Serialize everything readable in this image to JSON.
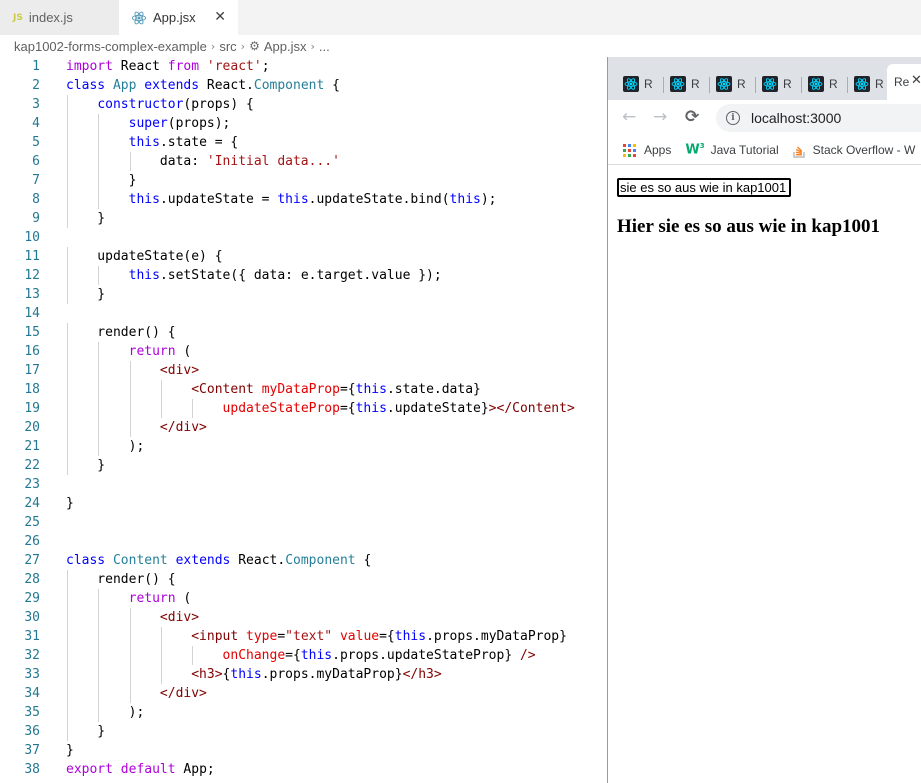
{
  "editor": {
    "tabs": [
      {
        "label": "index.js",
        "icon": "js-file-icon",
        "active": false
      },
      {
        "label": "App.jsx",
        "icon": "react-file-icon",
        "active": true
      }
    ],
    "tab_close_glyph": "✕",
    "breadcrumb": [
      "kap1002-forms-complex-example",
      "src",
      "App.jsx",
      "..."
    ],
    "lines": [
      [
        [
          "import",
          "kwc"
        ],
        [
          " React ",
          ""
        ],
        [
          "from",
          "kwc"
        ],
        [
          " ",
          ""
        ],
        [
          "'react'",
          "str"
        ],
        [
          ";",
          ""
        ]
      ],
      [
        [
          "class",
          "kw"
        ],
        [
          " ",
          ""
        ],
        [
          "App",
          "tk-type"
        ],
        [
          " ",
          ""
        ],
        [
          "extends",
          "kw"
        ],
        [
          " React.",
          ""
        ],
        [
          "Component",
          "tk-type"
        ],
        [
          " {",
          ""
        ]
      ],
      [
        [
          "    ",
          ""
        ],
        [
          "constructor",
          "kw"
        ],
        [
          "(props) {",
          ""
        ]
      ],
      [
        [
          "        ",
          ""
        ],
        [
          "super",
          "kw"
        ],
        [
          "(props);",
          ""
        ]
      ],
      [
        [
          "        ",
          ""
        ],
        [
          "this",
          "kw"
        ],
        [
          ".state = {",
          ""
        ]
      ],
      [
        [
          "            data: ",
          ""
        ],
        [
          "'Initial data...'",
          "str"
        ]
      ],
      [
        [
          "        }",
          ""
        ]
      ],
      [
        [
          "        ",
          ""
        ],
        [
          "this",
          "kw"
        ],
        [
          ".updateState = ",
          ""
        ],
        [
          "this",
          "kw"
        ],
        [
          ".updateState.bind(",
          ""
        ],
        [
          "this",
          "kw"
        ],
        [
          ");",
          ""
        ]
      ],
      [
        [
          "    }",
          ""
        ]
      ],
      [],
      [
        [
          "    updateState(e) {",
          ""
        ]
      ],
      [
        [
          "        ",
          ""
        ],
        [
          "this",
          "kw"
        ],
        [
          ".setState({ data: e.target.value });",
          ""
        ]
      ],
      [
        [
          "    }",
          ""
        ]
      ],
      [],
      [
        [
          "    render() {",
          ""
        ]
      ],
      [
        [
          "        ",
          ""
        ],
        [
          "return",
          "kwc"
        ],
        [
          " (",
          ""
        ]
      ],
      [
        [
          "            ",
          ""
        ],
        [
          "<div>",
          "tag"
        ]
      ],
      [
        [
          "                ",
          ""
        ],
        [
          "<Content",
          "tag"
        ],
        [
          " ",
          ""
        ],
        [
          "myDataProp",
          "attr"
        ],
        [
          "={",
          ""
        ],
        [
          "this",
          "kw"
        ],
        [
          ".state.data}",
          ""
        ]
      ],
      [
        [
          "                    ",
          ""
        ],
        [
          "updateStateProp",
          "attr"
        ],
        [
          "={",
          ""
        ],
        [
          "this",
          "kw"
        ],
        [
          ".updateState}",
          ""
        ],
        [
          "></Content>",
          "tag"
        ]
      ],
      [
        [
          "            ",
          ""
        ],
        [
          "</div>",
          "tag"
        ]
      ],
      [
        [
          "        );",
          ""
        ]
      ],
      [
        [
          "    }",
          ""
        ]
      ],
      [],
      [
        [
          "}",
          ""
        ]
      ],
      [],
      [],
      [
        [
          "class",
          "kw"
        ],
        [
          " ",
          ""
        ],
        [
          "Content",
          "tk-type"
        ],
        [
          " ",
          ""
        ],
        [
          "extends",
          "kw"
        ],
        [
          " React.",
          ""
        ],
        [
          "Component",
          "tk-type"
        ],
        [
          " {",
          ""
        ]
      ],
      [
        [
          "    render() {",
          ""
        ]
      ],
      [
        [
          "        ",
          ""
        ],
        [
          "return",
          "kwc"
        ],
        [
          " (",
          ""
        ]
      ],
      [
        [
          "            ",
          ""
        ],
        [
          "<div>",
          "tag"
        ]
      ],
      [
        [
          "                ",
          ""
        ],
        [
          "<input",
          "tag"
        ],
        [
          " ",
          ""
        ],
        [
          "type",
          "attr"
        ],
        [
          "=",
          ""
        ],
        [
          "\"text\"",
          "str"
        ],
        [
          " ",
          ""
        ],
        [
          "value",
          "attr"
        ],
        [
          "={",
          ""
        ],
        [
          "this",
          "kw"
        ],
        [
          ".props.myDataProp}",
          ""
        ]
      ],
      [
        [
          "                    ",
          ""
        ],
        [
          "onChange",
          "attr"
        ],
        [
          "={",
          ""
        ],
        [
          "this",
          "kw"
        ],
        [
          ".props.updateStateProp} ",
          ""
        ],
        [
          "/>",
          "tag"
        ]
      ],
      [
        [
          "                ",
          ""
        ],
        [
          "<h3>",
          "tag"
        ],
        [
          "{",
          ""
        ],
        [
          "this",
          "kw"
        ],
        [
          ".props.myDataProp}",
          ""
        ],
        [
          "</h3>",
          "tag"
        ]
      ],
      [
        [
          "            ",
          ""
        ],
        [
          "</div>",
          "tag"
        ]
      ],
      [
        [
          "        );",
          ""
        ]
      ],
      [
        [
          "    }",
          ""
        ]
      ],
      [
        [
          "}",
          ""
        ]
      ],
      [
        [
          "export",
          "kwc"
        ],
        [
          " ",
          ""
        ],
        [
          "default",
          "kwc"
        ],
        [
          " App;",
          ""
        ]
      ]
    ]
  },
  "browser": {
    "tab_label": "R",
    "active_tab_label": "Re",
    "tab_close_glyph": "✕",
    "back_glyph": "←",
    "forward_glyph": "→",
    "reload_glyph": "⟳",
    "info_glyph": "i",
    "url": "localhost:3000",
    "bookmarks": [
      {
        "label": "Apps",
        "icon": "apps-grid-icon"
      },
      {
        "label": "Java Tutorial",
        "icon": "w3schools-icon"
      },
      {
        "label": "Stack Overflow - W",
        "icon": "stackoverflow-icon"
      }
    ],
    "page": {
      "input_value": "sie es so aus wie in kap1001",
      "heading": "Hier sie es so aus wie in kap1001"
    }
  },
  "colors": {
    "keyword": "#0000ff",
    "control_keyword": "#af00db",
    "string": "#a31515",
    "jsx_attribute": "#e50000",
    "jsx_tag": "#800000",
    "line_number": "#237893",
    "react_blue": "#00d8ff"
  }
}
